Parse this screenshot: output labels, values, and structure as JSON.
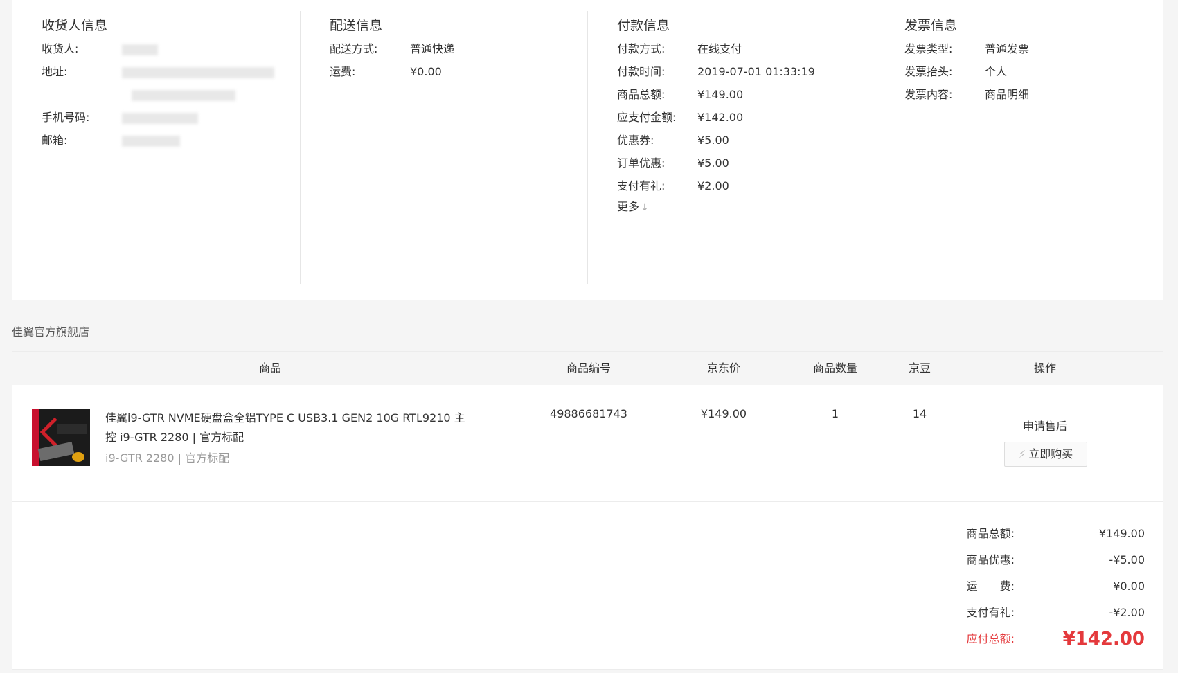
{
  "consignee": {
    "title": "收货人信息",
    "name_label": "收货人:",
    "address_label": "地址:",
    "phone_label": "手机号码:",
    "email_label": "邮箱:"
  },
  "delivery": {
    "title": "配送信息",
    "method_label": "配送方式:",
    "method_value": "普通快递",
    "fee_label": "运费:",
    "fee_value": "¥0.00"
  },
  "payment": {
    "title": "付款信息",
    "rows": [
      {
        "label": "付款方式:",
        "value": "在线支付"
      },
      {
        "label": "付款时间:",
        "value": "2019-07-01 01:33:19"
      },
      {
        "label": "商品总额:",
        "value": "¥149.00"
      },
      {
        "label": "应支付金额:",
        "value": "¥142.00"
      },
      {
        "label": "优惠券:",
        "value": "¥5.00"
      },
      {
        "label": "订单优惠:",
        "value": "¥5.00"
      },
      {
        "label": "支付有礼:",
        "value": "¥2.00"
      }
    ],
    "more_label": "更多",
    "more_icon": "chevron-double-down-icon"
  },
  "invoice": {
    "title": "发票信息",
    "rows": [
      {
        "label": "发票类型:",
        "value": "普通发票"
      },
      {
        "label": "发票抬头:",
        "value": "个人"
      },
      {
        "label": "发票内容:",
        "value": "商品明细"
      }
    ]
  },
  "shop": {
    "name": "佳翼官方旗舰店"
  },
  "table": {
    "headers": [
      "商品",
      "商品编号",
      "京东价",
      "商品数量",
      "京豆",
      "操作"
    ],
    "item": {
      "name": "佳翼i9-GTR NVME硬盘盒全铝TYPE C USB3.1 GEN2 10G RTL9210 主控 i9-GTR 2280 | 官方标配",
      "spec": "i9-GTR 2280 | 官方标配",
      "sku": "49886681743",
      "price": "¥149.00",
      "qty": "1",
      "beans": "14",
      "after_sale": "申请售后",
      "buy_label": "立即购买",
      "buy_icon": "lightning-icon"
    }
  },
  "summary": {
    "rows": [
      {
        "label": "商品总额:",
        "value": "¥149.00"
      },
      {
        "label": "商品优惠:",
        "value": "-¥5.00"
      },
      {
        "label": "运　　费:",
        "value": "¥0.00"
      },
      {
        "label": "支付有礼:",
        "value": "-¥2.00"
      }
    ],
    "grand_label": "应付总额:",
    "grand_value": "¥142.00",
    "accent": "#e4393c"
  }
}
